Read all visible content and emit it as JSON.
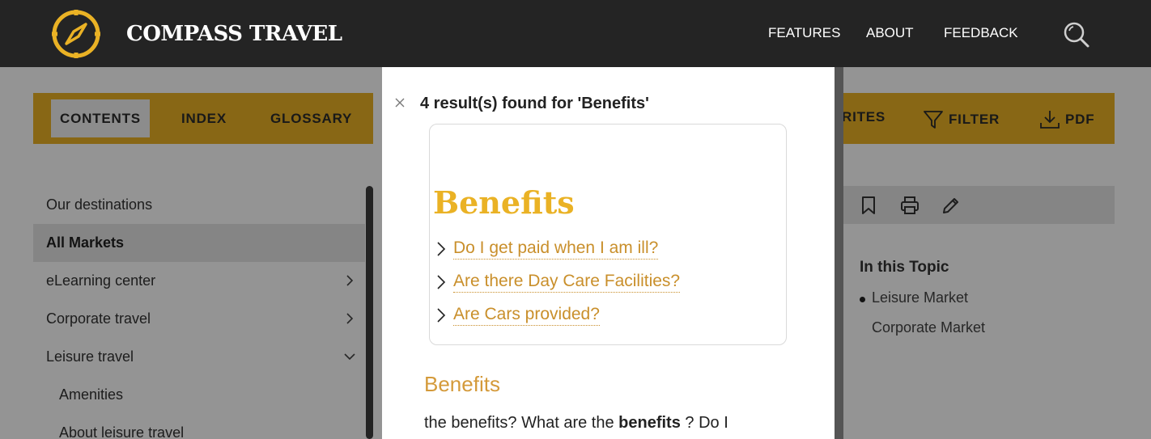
{
  "header": {
    "brand": "COMPASS TRAVEL",
    "nav": [
      "FEATURES",
      "ABOUT",
      "FEEDBACK"
    ],
    "icons": {
      "logo": "compass-icon",
      "search": "search-icon"
    }
  },
  "tabs": {
    "contents": "CONTENTS",
    "index": "INDEX",
    "glossary": "GLOSSARY"
  },
  "toolbar": {
    "favorites_partial": "RITES",
    "filter": "FILTER",
    "pdf": "PDF"
  },
  "sidebar": {
    "items": [
      {
        "label": "Our destinations"
      },
      {
        "label": "All Markets"
      },
      {
        "label": "eLearning center"
      },
      {
        "label": "Corporate travel"
      },
      {
        "label": "Leisure travel"
      },
      {
        "label": "Amenities"
      },
      {
        "label": "About leisure travel"
      }
    ]
  },
  "topic": {
    "title": "In this Topic",
    "links": [
      "Leisure Market",
      "Corporate Market"
    ]
  },
  "search": {
    "heading": "4 result(s) found for 'Benefits'",
    "card_title": "Benefits",
    "card_links": [
      "Do I get paid when I am ill?",
      "Are there Day Care Facilities?",
      "Are Cars provided?"
    ],
    "result2_title": "Benefits",
    "result2_text_before": "the benefits? What are the ",
    "result2_text_bold": "benefits",
    "result2_text_after": " ? Do I"
  },
  "colors": {
    "header_bg": "#242424",
    "accent": "#eab225",
    "link": "#c98f2b"
  }
}
